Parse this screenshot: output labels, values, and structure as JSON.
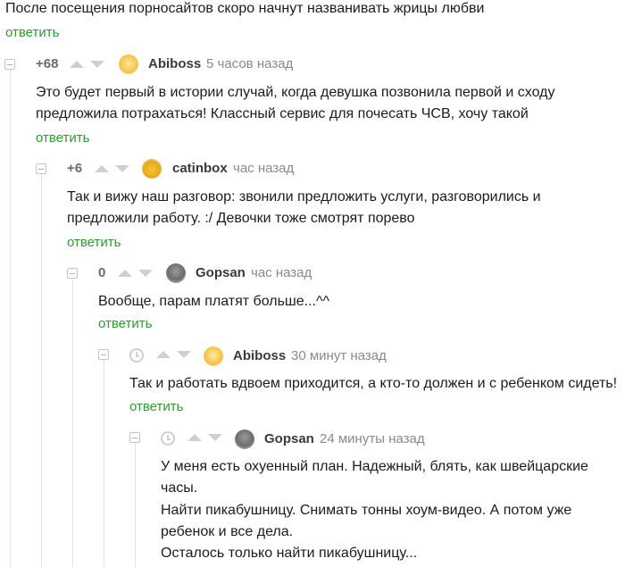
{
  "post": {
    "title": "После посещения порносайтов скоро начнут названивать жрицы любви",
    "reply": "ответить"
  },
  "comments": [
    {
      "rating": "+68",
      "author": "Abiboss",
      "time": "5 часов назад",
      "lines": [
        "Это будет первый в истории случай, когда девушка позвонила первой и сходу",
        "предложила потрахаться! Классный сервис для почесать ЧСВ, хочу такой"
      ],
      "reply": "ответить",
      "avatar": "abiboss-avatar"
    },
    {
      "rating": "+6",
      "author": "catinbox",
      "time": "час назад",
      "lines": [
        "Так и вижу наш разговор: звонили предложить услуги, разговорились и",
        "предложили работу. :/ Девочки тоже смотрят порево"
      ],
      "reply": "ответить",
      "avatar": "catinbox-avatar"
    },
    {
      "rating": "0",
      "author": "Gopsan",
      "time": "час назад",
      "lines": [
        "Вообще, парам платят больше...^^"
      ],
      "reply": "ответить",
      "avatar": "gopsan-avatar"
    },
    {
      "author": "Abiboss",
      "time": "30 минут назад",
      "lines": [
        "Так и работать вдвоем приходится, а кто-то должен и с ребенком сидеть!"
      ],
      "reply": "ответить",
      "avatar": "abiboss-avatar"
    },
    {
      "author": "Gopsan",
      "time": "24 минуты назад",
      "lines": [
        "У меня есть охуенный план. Надежный, блять, как швейцарские",
        "часы.",
        "Найти пикабушницу. Снимать тонны хоум-видео. А потом уже",
        "ребенок и все дела.",
        "Осталось только найти пикабушницу..."
      ],
      "avatar": "gopsan-avatar"
    }
  ],
  "colors": {
    "reply_link": "#2f9b2f",
    "text": "#1c1c1c",
    "muted": "#8a8a8a",
    "arrow": "#cfcfcf"
  }
}
